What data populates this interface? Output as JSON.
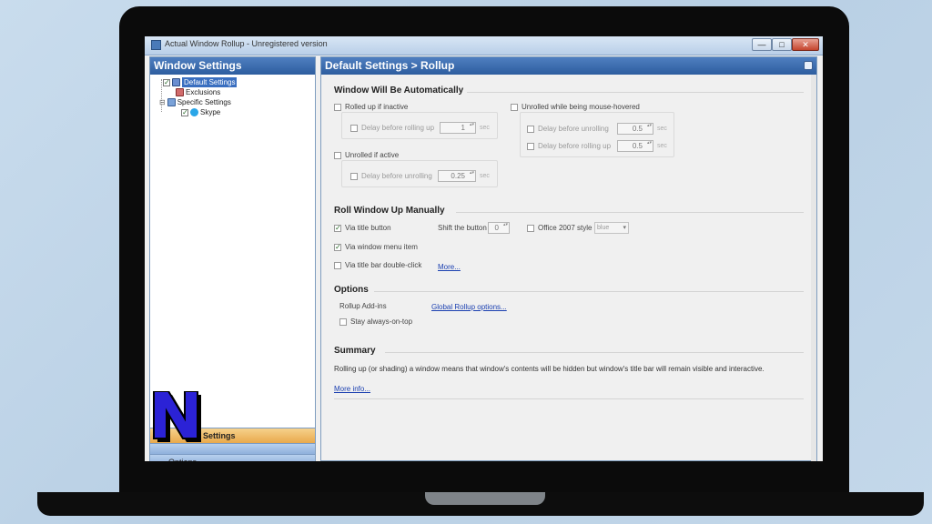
{
  "window": {
    "title": "Actual Window Rollup - Unregistered version",
    "controls": {
      "minimize": "—",
      "maximize": "□",
      "close": "✕"
    }
  },
  "left_pane": {
    "header": "Window Settings",
    "tree": [
      {
        "label": "Default Settings",
        "checked": true,
        "selected": true
      },
      {
        "label": "Exclusions"
      },
      {
        "label": "Specific Settings"
      },
      {
        "label": "Skype",
        "checked": true
      }
    ],
    "nav": [
      {
        "label": "Settings"
      },
      {
        "label": ""
      },
      {
        "label": "Options"
      }
    ]
  },
  "right_pane": {
    "header": "Default Settings > Rollup",
    "sections": {
      "auto": {
        "title": "Window Will Be Automatically",
        "rolled_up_inactive": "Rolled up if inactive",
        "delay_before_rolling_up": "Delay before rolling up",
        "delay_value_1": "1",
        "unrolled_if_active": "Unrolled if active",
        "delay_before_unrolling": "Delay before unrolling",
        "delay_value_2": "0.25",
        "unrolled_hovered": "Unrolled while being mouse-hovered",
        "delay_before_unrolling_2": "Delay before unrolling",
        "delay_value_3": "0.5",
        "delay_before_rolling_up_2": "Delay before rolling up",
        "delay_value_4": "0.5",
        "unit": "sec"
      },
      "manual": {
        "title": "Roll Window Up Manually",
        "via_title_button": "Via title button",
        "shift_label": "Shift the button",
        "shift_value": "0",
        "office_style": "Office 2007 style",
        "office_select": "blue",
        "via_window_menu": "Via window menu item",
        "via_double_click": "Via title bar double-click",
        "more_link": "More..."
      },
      "options": {
        "title": "Options",
        "rollup_addins": "Rollup Add-ins",
        "global_link": "Global Rollup options...",
        "stay_on_top": "Stay always-on-top"
      },
      "summary": {
        "title": "Summary",
        "text": "Rolling up (or shading) a window means that window's contents will be hidden but window's title bar will remain visible and interactive.",
        "more_info": "More info..."
      }
    }
  },
  "overlay": {
    "logo_letter": "N"
  }
}
